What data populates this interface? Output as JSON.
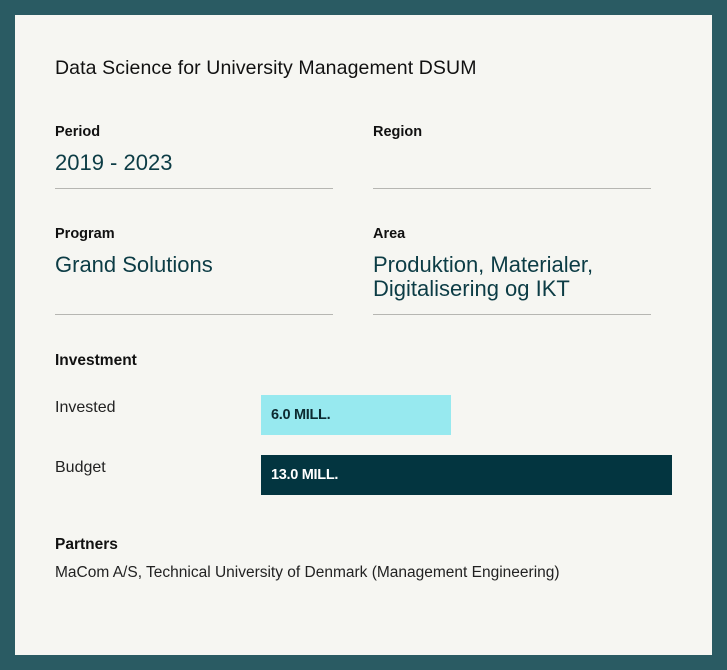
{
  "project": {
    "title": "Data Science for University Management DSUM"
  },
  "fields": {
    "period": {
      "label": "Period",
      "value": "2019 - 2023"
    },
    "region": {
      "label": "Region",
      "value": ""
    },
    "program": {
      "label": "Program",
      "value": "Grand Solutions"
    },
    "area": {
      "label": "Area",
      "value": "Produktion, Materialer, Digitalisering og IKT"
    }
  },
  "investment": {
    "heading": "Investment",
    "invested": {
      "label": "Invested",
      "value_text": "6.0 MILL.",
      "amount": 6.0
    },
    "budget": {
      "label": "Budget",
      "value_text": "13.0 MILL.",
      "amount": 13.0
    }
  },
  "partners": {
    "heading": "Partners",
    "text": "MaCom A/S, Technical University of Denmark (Management Engineering)"
  },
  "colors": {
    "background": "#2a5b63",
    "card": "#f6f6f2",
    "invested_bar": "#97e9ef",
    "budget_bar": "#033540",
    "value_text": "#0c3c45"
  }
}
